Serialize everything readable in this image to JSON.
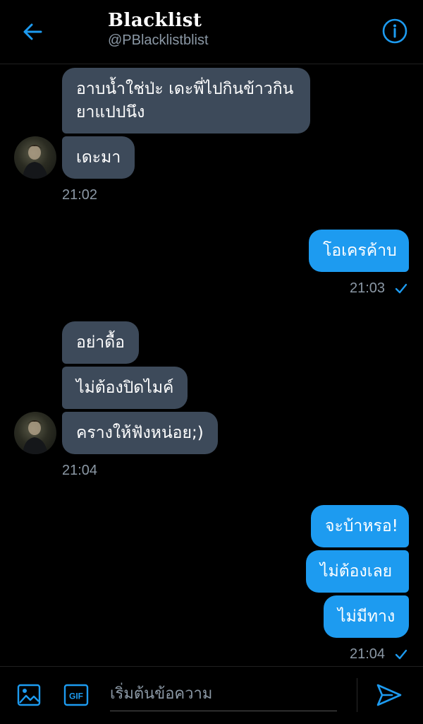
{
  "header": {
    "title": "Blacklist",
    "handle": "@PBlacklistblist",
    "back_icon": "arrow-left-icon",
    "info_icon": "info-circle-icon"
  },
  "colors": {
    "accent": "#1d9bf0",
    "incoming_bubble": "#3d4a5a",
    "muted_text": "#8b98a5",
    "background": "#000000"
  },
  "conversation": {
    "group1": {
      "messages": [
        "อาบน้ำใช่ป่ะ เดะพี่ไปกินข้าวกิน",
        "ยาแปปนึง",
        "เดะมา"
      ],
      "time": "21:02"
    },
    "group2": {
      "messages": [
        "โอเครค้าบ"
      ],
      "time": "21:03"
    },
    "group3": {
      "messages": [
        "อย่าดื้อ",
        "ไม่ต้องปิดไมค์",
        "ครางให้ฟังหน่อย;)"
      ],
      "time": "21:04"
    },
    "group4": {
      "messages": [
        "จะบ้าหรอ!",
        "ไม่ต้องเลย",
        "ไม่มีทาง"
      ],
      "time": "21:04"
    }
  },
  "composer": {
    "placeholder": "เริ่มต้นข้อความ",
    "media_icon": "image-icon",
    "gif_label": "GIF",
    "send_icon": "send-icon"
  }
}
